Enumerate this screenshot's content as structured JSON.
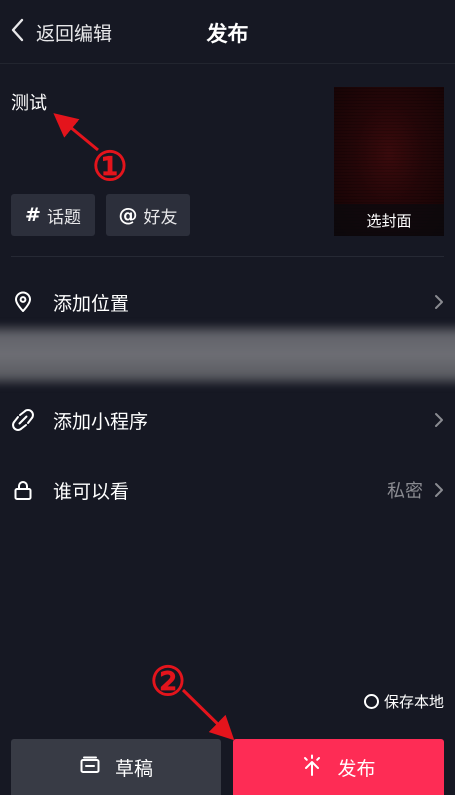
{
  "header": {
    "back_label": "返回编辑",
    "title": "发布"
  },
  "caption": {
    "text": "测试"
  },
  "cover": {
    "label": "选封面"
  },
  "chips": {
    "topic_symbol": "#",
    "topic_label": "话题",
    "friend_symbol": "@",
    "friend_label": "好友"
  },
  "rows": {
    "location_label": "添加位置",
    "mini_program_label": "添加小程序",
    "visibility_label": "谁可以看",
    "visibility_value": "私密"
  },
  "save_local": {
    "label": "保存本地"
  },
  "bottom": {
    "draft_label": "草稿",
    "publish_label": "发布"
  },
  "annotations": {
    "step1": "①",
    "step2": "②"
  },
  "colors": {
    "background": "#161823",
    "publish": "#fe2c55",
    "draft": "#383b45",
    "annotation": "#e4141c"
  }
}
